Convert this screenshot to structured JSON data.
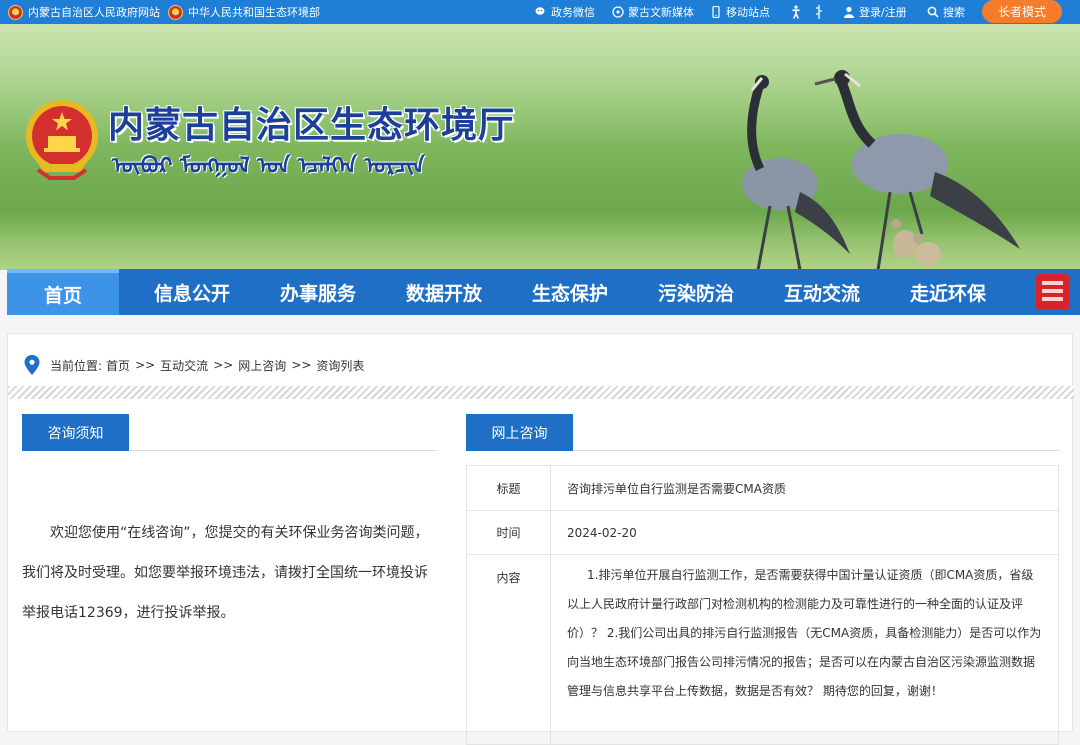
{
  "topbar": {
    "link1": "内蒙古自治区人民政府网站",
    "link2": "中华人民共和国生态环境部",
    "wechat": "政务微信",
    "mongol_media": "蒙古文新媒体",
    "mobile": "移动站点",
    "login": "登录/注册",
    "search": "搜索",
    "elder_mode": "长者模式"
  },
  "banner": {
    "title": "内蒙古自治区生态环境厅",
    "title_mongolian": "ᠥᠪᠦᠷ ᠮᠣᠩᠭᠣᠯ ᠤᠨ ᠡᠴᠡᠯᠭᠡᠨ ᠣᠷᠴᠢᠨ"
  },
  "nav": {
    "items": [
      "首页",
      "信息公开",
      "办事服务",
      "数据开放",
      "生态保护",
      "污染防治",
      "互动交流",
      "走近环保"
    ]
  },
  "breadcrumb": {
    "label": "当前位置:",
    "path": [
      "首页",
      "互动交流",
      "网上咨询",
      "资询列表"
    ],
    "sep": ">>"
  },
  "left": {
    "tab": "咨询须知",
    "notice": "欢迎您使用“在线咨询”，您提交的有关环保业务咨询类问题，我们将及时受理。如您要举报环境违法，请拨打全国统一环境投诉举报电话12369，进行投诉举报。"
  },
  "right": {
    "tab": "网上咨询",
    "rows": {
      "title_label": "标题",
      "title_value": "咨询排污单位自行监测是否需要CMA资质",
      "time_label": "时间",
      "time_value": "2024-02-20",
      "content_label": "内容",
      "content_value": "1.排污单位开展自行监测工作，是否需要获得中国计量认证资质（即CMA资质，省级以上人民政府计量行政部门对检测机构的检测能力及可靠性进行的一种全面的认证及评价）？ 2.我们公司出具的排污自行监测报告（无CMA资质，具备检测能力）是否可以作为向当地生态环境部门报告公司排污情况的报告；是否可以在内蒙古自治区污染源监测数据管理与信息共享平台上传数据，数据是否有效？ 期待您的回复，谢谢！"
    }
  },
  "colors": {
    "topbar": "#1f7fd6",
    "nav": "#1e6fc5",
    "nav_active": "#3d93e8",
    "elder_button": "#f57c2a",
    "title_text": "#1c3f9a"
  }
}
